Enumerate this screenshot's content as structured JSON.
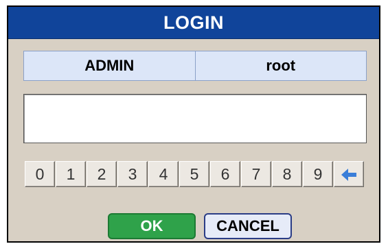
{
  "dialog": {
    "title": "LOGIN"
  },
  "user": {
    "role": "ADMIN",
    "name": "root"
  },
  "password": {
    "value": "",
    "placeholder": ""
  },
  "keypad": {
    "keys": [
      "0",
      "1",
      "2",
      "3",
      "4",
      "5",
      "6",
      "7",
      "8",
      "9"
    ],
    "backspace_icon": "left-arrow-icon"
  },
  "buttons": {
    "ok_label": "OK",
    "cancel_label": "CANCEL"
  },
  "colors": {
    "title_bar": "#10449a",
    "ok_button": "#2fa24a",
    "backspace_arrow": "#3a7ed8"
  }
}
